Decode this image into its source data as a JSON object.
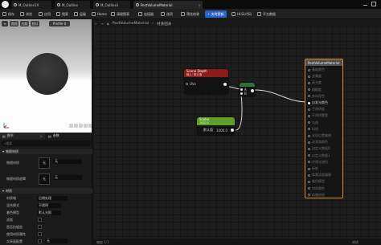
{
  "tabs": [
    {
      "label": "M_Outline1X",
      "active": false
    },
    {
      "label": "M_Outline",
      "active": false
    },
    {
      "label": "M_Outline1",
      "active": false
    },
    {
      "label": "PostVolumeMaterial",
      "active": true
    }
  ],
  "toolbar": {
    "save": "保存",
    "browse": "浏览",
    "apply": "应用",
    "search": "搜索",
    "hierarchy": "层级",
    "hierarchy_buttons": "Home",
    "clean_graph": "清理图表",
    "connectors": "连接器",
    "expressions": "选项",
    "stats": "预览结果",
    "live_update": "实时更新",
    "hlsl": "HLSL代码",
    "platform": "平台数据"
  },
  "viewport": {
    "buttons": [
      "视口",
      "透视",
      "光照",
      "Profile 0"
    ],
    "icons": [
      "sphere-icon",
      "cylinder-icon",
      "cube-icon",
      "plane-icon",
      "teapot-icon",
      "settings-icon"
    ]
  },
  "details": {
    "tabs": [
      "细节",
      "参数"
    ],
    "search_placeholder": "搜索",
    "sections": {
      "physics": "物理材质",
      "material": "材质"
    },
    "physics_rows": [
      {
        "label": "物理材质",
        "value": "无"
      },
      {
        "label": "物理材质遮罩",
        "value": "无"
      }
    ],
    "material_rows": [
      {
        "label": "材质域",
        "value": "后期处理"
      },
      {
        "label": "混合模式",
        "value": "不透明"
      },
      {
        "label": "着色模型",
        "value": "默认光照"
      },
      {
        "label": "双面",
        "value": ""
      },
      {
        "label": "是否抗锯齿",
        "value": ""
      },
      {
        "label": "使用材质属性",
        "value": ""
      },
      {
        "label": "次表面配置",
        "value": "无"
      }
    ]
  },
  "graph": {
    "breadcrumb": [
      "PostVolumeMaterial",
      "材质图表"
    ],
    "scene_depth": {
      "title": "Scene Depth",
      "subtitle": "输入: 默认值",
      "pin_uv": "UVs",
      "pin_out": ""
    },
    "scalar": {
      "title": "1000.0",
      "subtitle": "Scalar",
      "param_label": "默认值",
      "param_value": "1000.0"
    },
    "divide": {
      "title": "÷",
      "pin_a": "A",
      "pin_b": "B"
    },
    "output": {
      "title": "PostVolumeMaterial",
      "pins": [
        "基础颜色",
        "金属度",
        "高光度",
        "粗糙度",
        "各向异性",
        "自发光颜色",
        "不透明度",
        "不透明蒙版",
        "法线",
        "切线",
        "全局位置偏移",
        "次表面颜色",
        "自定义数据0",
        "自定义数据1",
        "环境光遮挡",
        "折射",
        "像素深度偏移",
        "着色模型",
        "材质属性",
        "前端材质"
      ]
    },
    "active_pin": "自发光颜色"
  },
  "bottom": {
    "zoom": "缩放 1:1",
    "status": "材质"
  }
}
